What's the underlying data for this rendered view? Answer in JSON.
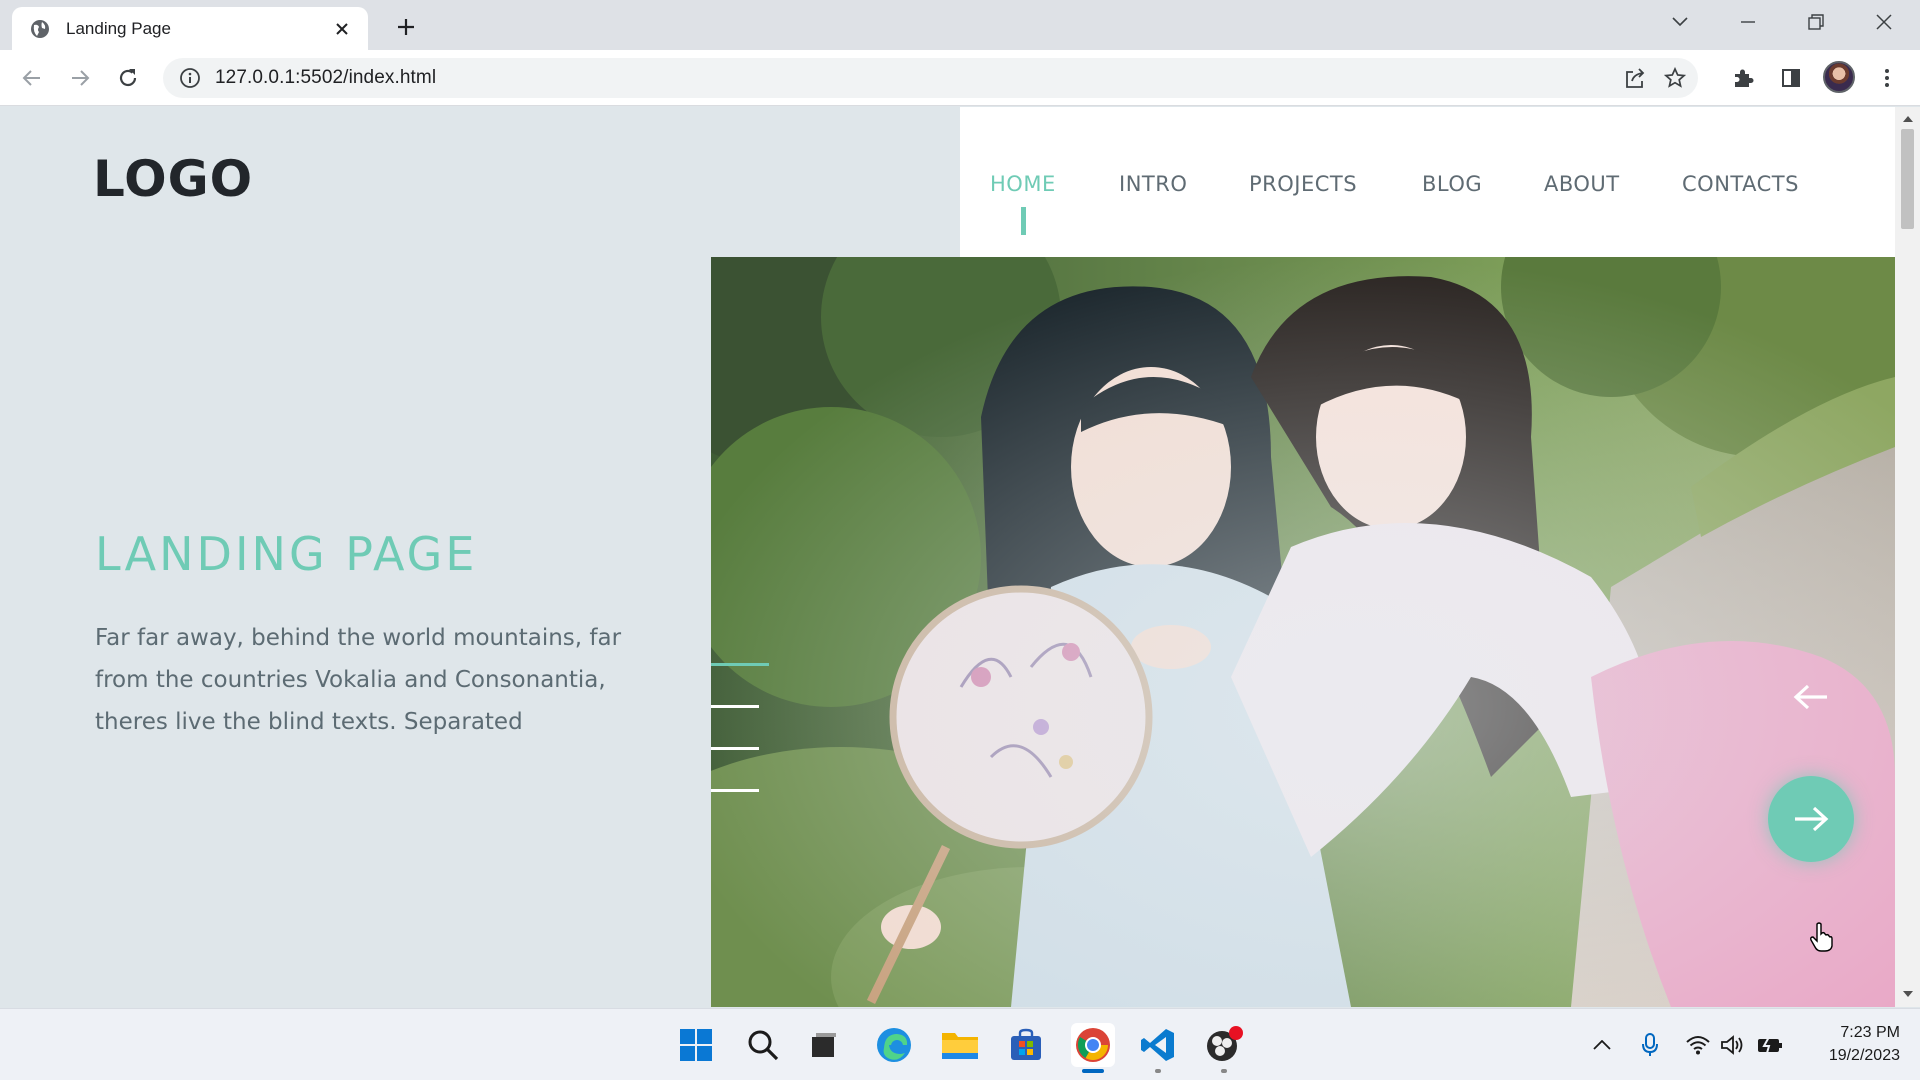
{
  "browser": {
    "tab_title": "Landing Page",
    "url": "127.0.0.1:5502/index.html"
  },
  "page": {
    "logo": "LOGO",
    "nav": [
      {
        "label": "HOME",
        "active": true
      },
      {
        "label": "INTRO",
        "active": false
      },
      {
        "label": "PROJECTS",
        "active": false
      },
      {
        "label": "BLOG",
        "active": false
      },
      {
        "label": "ABOUT",
        "active": false
      },
      {
        "label": "CONTACTS",
        "active": false
      }
    ],
    "hero_title": "LANDING PAGE",
    "hero_text": "Far far away, behind the world mountains, far from the countries Vokalia and Consonantia, theres live the blind texts. Separated",
    "slide_count": 4,
    "active_slide": 1,
    "prev_icon": "arrow-left-icon",
    "next_icon": "arrow-right-icon",
    "accent_color": "#6fcbb5"
  },
  "taskbar": {
    "apps": [
      "windows-start-icon",
      "search-icon",
      "task-view-icon",
      "edge-icon",
      "file-explorer-icon",
      "store-icon",
      "chrome-icon",
      "vscode-icon",
      "obs-icon"
    ],
    "time": "7:23 PM",
    "date": "19/2/2023"
  }
}
